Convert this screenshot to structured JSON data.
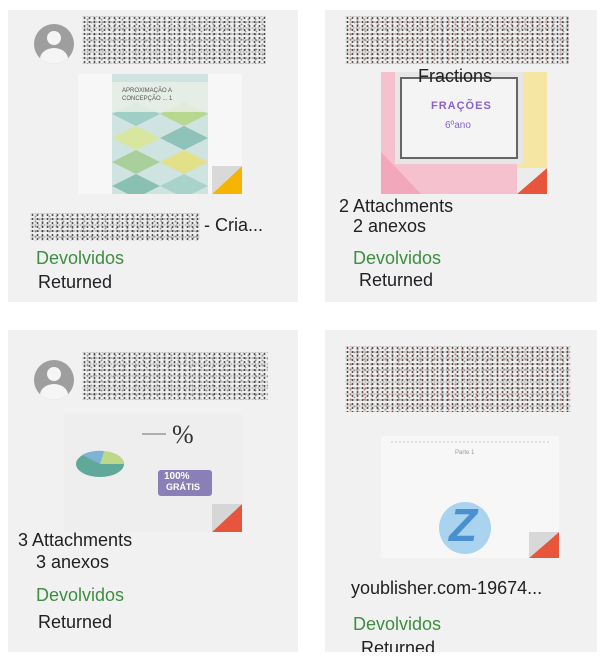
{
  "cards": [
    {
      "title_suffix": "- Cria...",
      "status_pt": "Devolvidos",
      "status_en": "Returned",
      "thumb_lines": [
        "APROXIMAÇÃO A",
        "CONCEPÇÃO ... 1"
      ]
    },
    {
      "overlay_title": "Fractions",
      "thumb_title": "FRAÇÕES",
      "thumb_subtitle": "6ºano",
      "attachments_en": "2 Attachments",
      "attachments_pt": "2 anexos",
      "status_pt": "Devolvidos",
      "status_en": "Returned"
    },
    {
      "thumb_percent": "%",
      "thumb_badge_top": "100%",
      "thumb_badge_bottom": "GRÁTIS",
      "attachments_en": "3 Attachments",
      "attachments_pt": "3 anexos",
      "status_pt": "Devolvidos",
      "status_en": "Returned"
    },
    {
      "thumb_caption": "Parte 1",
      "thumb_logo_letter": "Z",
      "title": "youblisher.com-19674...",
      "status_pt": "Devolvidos",
      "status_en": "Returned"
    }
  ],
  "colors": {
    "card_bg": "#f1f1f1",
    "status_green": "#3e8e41",
    "fold_red": "#e8553d",
    "fold_orange": "#f4b400"
  },
  "icons": [
    "avatar-icon",
    "corner-fold-icon",
    "pie-chart-icon"
  ]
}
